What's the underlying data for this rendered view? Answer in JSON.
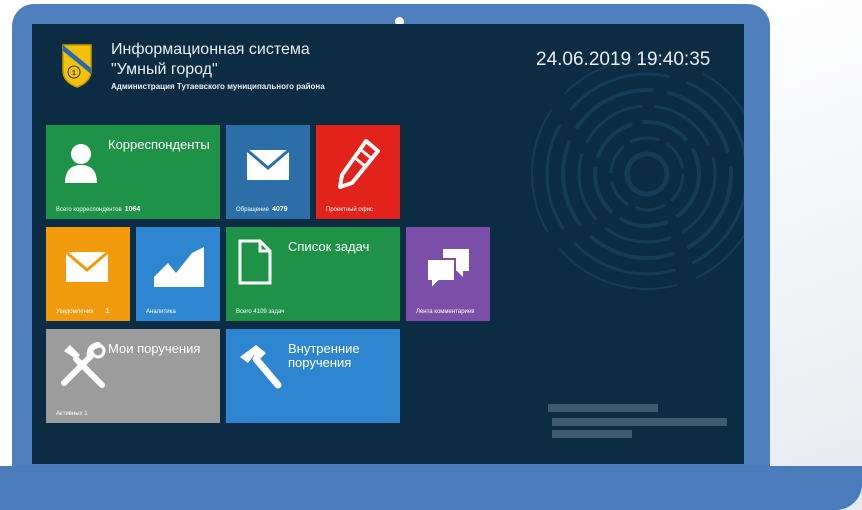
{
  "app": {
    "title_line1": "Информационная система",
    "title_line2": "\"Умный город\"",
    "subtitle": "Администрация Тутаевского муниципального района",
    "datetime": "24.06.2019 19:40:35"
  },
  "tiles": {
    "correspondents": {
      "title": "Корреспонденты",
      "footer_label": "Всего корреспондентов",
      "footer_value": "1064",
      "color": "#1e9247",
      "icon": "user-icon"
    },
    "appeals": {
      "footer_label": "Обращение",
      "footer_value": "4079",
      "color": "#2c6fa8",
      "icon": "envelope-icon"
    },
    "project_office": {
      "footer_label": "Проектный офис",
      "color": "#e3221b",
      "icon": "pen-icon"
    },
    "notifications": {
      "footer_label": "Уведомления",
      "footer_value": "1",
      "color": "#f19b0c",
      "icon": "envelope-icon"
    },
    "analytics": {
      "footer_label": "Аналитика",
      "color": "#2f86d0",
      "icon": "chart-icon"
    },
    "tasks": {
      "title": "Список задач",
      "footer_label": "Всего 4109 задач",
      "color": "#1e9247",
      "icon": "document-icon"
    },
    "comments": {
      "footer_label": "Лента комментариев",
      "color": "#7b4fa8",
      "icon": "chat-icon"
    },
    "my_orders": {
      "title": "Мои поручения",
      "footer_label": "Активных 1",
      "color": "#9c9c9c",
      "icon": "tools-icon"
    },
    "internal_orders": {
      "title": "Внутренние поручения",
      "color": "#2f86d0",
      "icon": "hammer-icon"
    }
  }
}
